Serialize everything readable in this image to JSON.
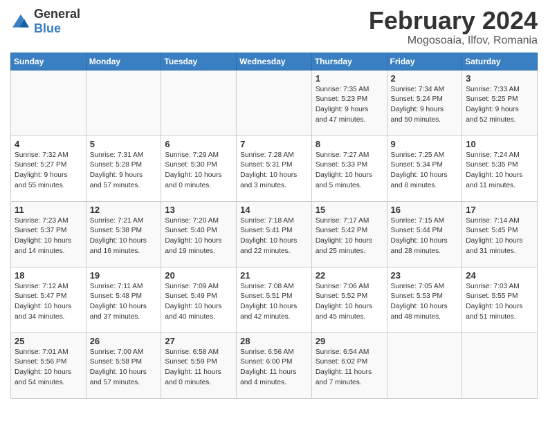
{
  "logo": {
    "general": "General",
    "blue": "Blue"
  },
  "title": {
    "month": "February 2024",
    "location": "Mogosoaia, Ilfov, Romania"
  },
  "headers": [
    "Sunday",
    "Monday",
    "Tuesday",
    "Wednesday",
    "Thursday",
    "Friday",
    "Saturday"
  ],
  "weeks": [
    [
      {
        "day": "",
        "info": ""
      },
      {
        "day": "",
        "info": ""
      },
      {
        "day": "",
        "info": ""
      },
      {
        "day": "",
        "info": ""
      },
      {
        "day": "1",
        "info": "Sunrise: 7:35 AM\nSunset: 5:23 PM\nDaylight: 9 hours\nand 47 minutes."
      },
      {
        "day": "2",
        "info": "Sunrise: 7:34 AM\nSunset: 5:24 PM\nDaylight: 9 hours\nand 50 minutes."
      },
      {
        "day": "3",
        "info": "Sunrise: 7:33 AM\nSunset: 5:25 PM\nDaylight: 9 hours\nand 52 minutes."
      }
    ],
    [
      {
        "day": "4",
        "info": "Sunrise: 7:32 AM\nSunset: 5:27 PM\nDaylight: 9 hours\nand 55 minutes."
      },
      {
        "day": "5",
        "info": "Sunrise: 7:31 AM\nSunset: 5:28 PM\nDaylight: 9 hours\nand 57 minutes."
      },
      {
        "day": "6",
        "info": "Sunrise: 7:29 AM\nSunset: 5:30 PM\nDaylight: 10 hours\nand 0 minutes."
      },
      {
        "day": "7",
        "info": "Sunrise: 7:28 AM\nSunset: 5:31 PM\nDaylight: 10 hours\nand 3 minutes."
      },
      {
        "day": "8",
        "info": "Sunrise: 7:27 AM\nSunset: 5:33 PM\nDaylight: 10 hours\nand 5 minutes."
      },
      {
        "day": "9",
        "info": "Sunrise: 7:25 AM\nSunset: 5:34 PM\nDaylight: 10 hours\nand 8 minutes."
      },
      {
        "day": "10",
        "info": "Sunrise: 7:24 AM\nSunset: 5:35 PM\nDaylight: 10 hours\nand 11 minutes."
      }
    ],
    [
      {
        "day": "11",
        "info": "Sunrise: 7:23 AM\nSunset: 5:37 PM\nDaylight: 10 hours\nand 14 minutes."
      },
      {
        "day": "12",
        "info": "Sunrise: 7:21 AM\nSunset: 5:38 PM\nDaylight: 10 hours\nand 16 minutes."
      },
      {
        "day": "13",
        "info": "Sunrise: 7:20 AM\nSunset: 5:40 PM\nDaylight: 10 hours\nand 19 minutes."
      },
      {
        "day": "14",
        "info": "Sunrise: 7:18 AM\nSunset: 5:41 PM\nDaylight: 10 hours\nand 22 minutes."
      },
      {
        "day": "15",
        "info": "Sunrise: 7:17 AM\nSunset: 5:42 PM\nDaylight: 10 hours\nand 25 minutes."
      },
      {
        "day": "16",
        "info": "Sunrise: 7:15 AM\nSunset: 5:44 PM\nDaylight: 10 hours\nand 28 minutes."
      },
      {
        "day": "17",
        "info": "Sunrise: 7:14 AM\nSunset: 5:45 PM\nDaylight: 10 hours\nand 31 minutes."
      }
    ],
    [
      {
        "day": "18",
        "info": "Sunrise: 7:12 AM\nSunset: 5:47 PM\nDaylight: 10 hours\nand 34 minutes."
      },
      {
        "day": "19",
        "info": "Sunrise: 7:11 AM\nSunset: 5:48 PM\nDaylight: 10 hours\nand 37 minutes."
      },
      {
        "day": "20",
        "info": "Sunrise: 7:09 AM\nSunset: 5:49 PM\nDaylight: 10 hours\nand 40 minutes."
      },
      {
        "day": "21",
        "info": "Sunrise: 7:08 AM\nSunset: 5:51 PM\nDaylight: 10 hours\nand 42 minutes."
      },
      {
        "day": "22",
        "info": "Sunrise: 7:06 AM\nSunset: 5:52 PM\nDaylight: 10 hours\nand 45 minutes."
      },
      {
        "day": "23",
        "info": "Sunrise: 7:05 AM\nSunset: 5:53 PM\nDaylight: 10 hours\nand 48 minutes."
      },
      {
        "day": "24",
        "info": "Sunrise: 7:03 AM\nSunset: 5:55 PM\nDaylight: 10 hours\nand 51 minutes."
      }
    ],
    [
      {
        "day": "25",
        "info": "Sunrise: 7:01 AM\nSunset: 5:56 PM\nDaylight: 10 hours\nand 54 minutes."
      },
      {
        "day": "26",
        "info": "Sunrise: 7:00 AM\nSunset: 5:58 PM\nDaylight: 10 hours\nand 57 minutes."
      },
      {
        "day": "27",
        "info": "Sunrise: 6:58 AM\nSunset: 5:59 PM\nDaylight: 11 hours\nand 0 minutes."
      },
      {
        "day": "28",
        "info": "Sunrise: 6:56 AM\nSunset: 6:00 PM\nDaylight: 11 hours\nand 4 minutes."
      },
      {
        "day": "29",
        "info": "Sunrise: 6:54 AM\nSunset: 6:02 PM\nDaylight: 11 hours\nand 7 minutes."
      },
      {
        "day": "",
        "info": ""
      },
      {
        "day": "",
        "info": ""
      }
    ]
  ]
}
